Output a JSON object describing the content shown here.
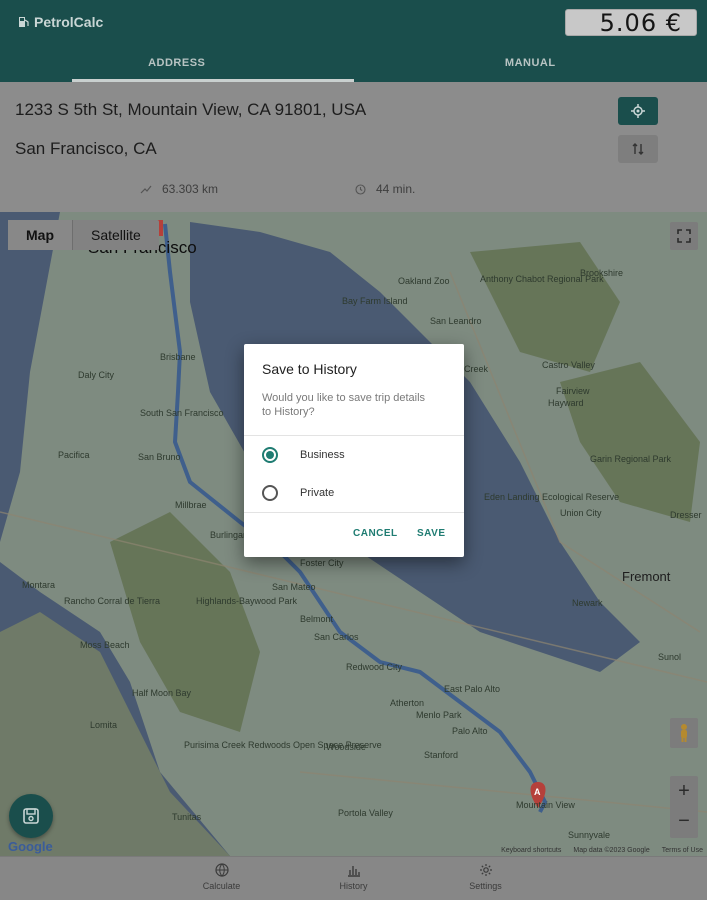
{
  "header": {
    "app_name": "PetrolCalc",
    "price": "5.06 €",
    "tabs": [
      {
        "label": "ADDRESS",
        "active": true
      },
      {
        "label": "MANUAL",
        "active": false
      }
    ]
  },
  "route": {
    "origin": "1233 S 5th St, Mountain View, CA 91801, USA",
    "destination": "San Francisco, CA",
    "distance": "63.303 km",
    "duration": "44 min."
  },
  "map": {
    "type_options": [
      "Map",
      "Satellite"
    ],
    "selected_type": "Map",
    "labels": {
      "sf": "San Francisco",
      "fremont": "Fremont",
      "oakland_zoo": "Oakland Zoo",
      "san_leandro": "San Leandro",
      "hayward": "Hayward",
      "castro_valley": "Castro Valley",
      "daly_city": "Daly City",
      "brisbane": "Brisbane",
      "south_sf": "South San Francisco",
      "san_bruno": "San Bruno",
      "pacifica": "Pacifica",
      "millbrae": "Millbrae",
      "burlingame": "Burlingame",
      "foster_city": "Foster City",
      "san_mateo": "San Mateo",
      "belmont": "Belmont",
      "san_carlos": "San Carlos",
      "redwood_city": "Redwood City",
      "east_palo_alto": "East Palo Alto",
      "menlo_park": "Menlo Park",
      "palo_alto": "Palo Alto",
      "atherton": "Atherton",
      "woodside": "Woodside",
      "stanford": "Stanford",
      "half_moon_bay": "Half Moon Bay",
      "montara": "Montara",
      "moss_beach": "Moss Beach",
      "portola_valley": "Portola Valley",
      "tunitas": "Tunitas",
      "newark": "Newark",
      "union_city": "Union City",
      "sunnyvale": "Sunnyvale",
      "mountain_view": "Mountain View",
      "hmsp": "Highlands-Baywood Park",
      "rancho_corral": "Rancho Corral de Tierra",
      "eden_landing": "Eden Landing Ecological Reserve",
      "garin": "Garin Regional Park",
      "anthony_chabot": "Anthony Chabot Regional Park",
      "bay_farm": "Bay Farm Island",
      "purisima": "Purisima Creek Redwoods Open Space Preserve",
      "brookshire": "Brookshire",
      "fairview": "Fairview",
      "sunol": "Sunol",
      "dresser": "Dresser",
      "lomita": "Lomita",
      "sausal": "Sausal Creek",
      "marker_a": "A"
    },
    "attribution": {
      "shortcuts": "Keyboard shortcuts",
      "data": "Map data ©2023 Google",
      "terms": "Terms of Use"
    },
    "google_logo": "Google",
    "zoom_in": "+",
    "zoom_out": "−"
  },
  "dialog": {
    "title": "Save to History",
    "message": "Would you like to save trip details to History?",
    "options": [
      {
        "label": "Business",
        "checked": true
      },
      {
        "label": "Private",
        "checked": false
      }
    ],
    "cancel": "CANCEL",
    "save": "SAVE"
  },
  "bottom_nav": [
    {
      "label": "Calculate",
      "icon": "globe-icon"
    },
    {
      "label": "History",
      "icon": "chart-icon"
    },
    {
      "label": "Settings",
      "icon": "gear-icon"
    }
  ]
}
